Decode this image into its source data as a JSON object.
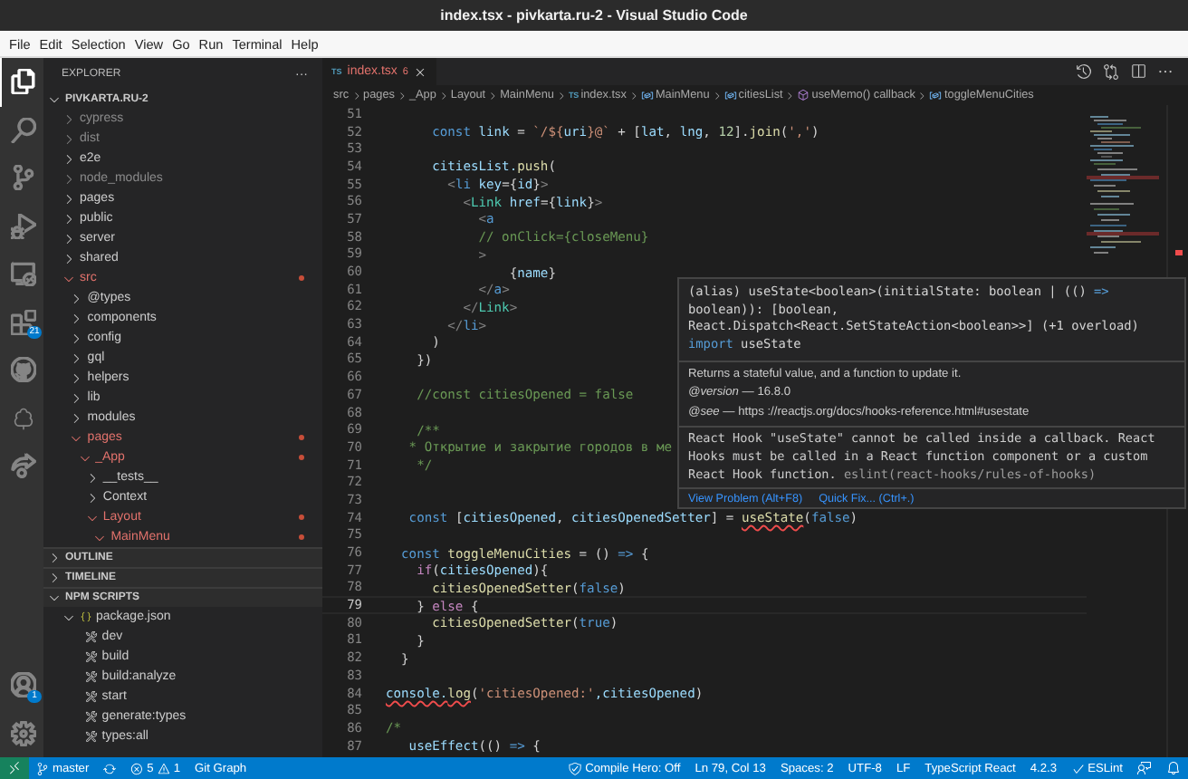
{
  "window": {
    "title": "index.tsx - pivkarta.ru-2 - Visual Studio Code"
  },
  "menu": [
    "File",
    "Edit",
    "Selection",
    "View",
    "Go",
    "Run",
    "Terminal",
    "Help"
  ],
  "activity_bar": {
    "top": [
      {
        "kind": "explorer",
        "selected": true
      },
      {
        "kind": "search",
        "selected": false
      },
      {
        "kind": "scm",
        "selected": false
      },
      {
        "kind": "debug",
        "selected": false
      },
      {
        "kind": "remote",
        "selected": false
      },
      {
        "kind": "extensions",
        "selected": false,
        "badge": "21"
      },
      {
        "kind": "github",
        "selected": false
      },
      {
        "kind": "tree",
        "selected": false
      },
      {
        "kind": "liveshare",
        "selected": false
      }
    ],
    "bottom": [
      {
        "kind": "account",
        "badge": "1"
      },
      {
        "kind": "settings"
      }
    ]
  },
  "sidebar": {
    "title": "EXPLORER",
    "more": "···",
    "project": {
      "title": "PIVKARTA.RU-2",
      "expanded": true,
      "items": [
        {
          "label": "cypress",
          "expanded": false,
          "modified": false,
          "ignored": true
        },
        {
          "label": "dist",
          "expanded": false,
          "modified": false,
          "ignored": true
        },
        {
          "label": "e2e",
          "expanded": false,
          "modified": false,
          "ignored": false
        },
        {
          "label": "node_modules",
          "expanded": false,
          "modified": false,
          "ignored": true
        },
        {
          "label": "pages",
          "expanded": false,
          "modified": false,
          "ignored": false
        },
        {
          "label": "public",
          "expanded": false,
          "modified": false,
          "ignored": false
        },
        {
          "label": "server",
          "expanded": false,
          "modified": false,
          "ignored": false
        },
        {
          "label": "shared",
          "expanded": false,
          "modified": false,
          "ignored": false
        },
        {
          "label": "src",
          "expanded": true,
          "modified": true,
          "ignored": false,
          "children": [
            {
              "label": "@types",
              "expanded": false,
              "modified": false,
              "ignored": false
            },
            {
              "label": "components",
              "expanded": false,
              "modified": false,
              "ignored": false
            },
            {
              "label": "config",
              "expanded": false,
              "modified": false,
              "ignored": false
            },
            {
              "label": "gql",
              "expanded": false,
              "modified": false,
              "ignored": false
            },
            {
              "label": "helpers",
              "expanded": false,
              "modified": false,
              "ignored": false
            },
            {
              "label": "lib",
              "expanded": false,
              "modified": false,
              "ignored": false
            },
            {
              "label": "modules",
              "expanded": false,
              "modified": false,
              "ignored": false
            },
            {
              "label": "pages",
              "expanded": true,
              "modified": true,
              "ignored": false,
              "children": [
                {
                  "label": "_App",
                  "expanded": true,
                  "modified": true,
                  "ignored": false,
                  "children": [
                    {
                      "label": "__tests__",
                      "expanded": false,
                      "modified": false,
                      "ignored": false
                    },
                    {
                      "label": "Context",
                      "expanded": false,
                      "modified": false,
                      "ignored": false
                    },
                    {
                      "label": "Layout",
                      "expanded": true,
                      "modified": true,
                      "ignored": false,
                      "children": [
                        {
                          "label": "MainMenu",
                          "expanded": true,
                          "modified": true,
                          "ignored": false
                        }
                      ]
                    }
                  ]
                }
              ]
            }
          ]
        }
      ]
    },
    "sections": [
      {
        "title": "OUTLINE",
        "expanded": false
      },
      {
        "title": "TIMELINE",
        "expanded": false
      },
      {
        "title": "NPM SCRIPTS",
        "expanded": true,
        "items": [
          {
            "kind": "package",
            "label": "package.json",
            "expanded": true,
            "children": [
              {
                "kind": "script",
                "label": "dev"
              },
              {
                "kind": "script",
                "label": "build"
              },
              {
                "kind": "script",
                "label": "build:analyze"
              },
              {
                "kind": "script",
                "label": "start"
              },
              {
                "kind": "script",
                "label": "generate:types"
              },
              {
                "kind": "script",
                "label": "types:all"
              }
            ]
          }
        ]
      }
    ]
  },
  "tabs": [
    {
      "file_icon": "TS",
      "label": "index.tsx",
      "problems": "6",
      "selected": true
    }
  ],
  "breadcrumbs": [
    {
      "kind": "folder",
      "text": "src"
    },
    {
      "kind": "folder",
      "text": "pages"
    },
    {
      "kind": "folder",
      "text": "_App"
    },
    {
      "kind": "folder",
      "text": "Layout"
    },
    {
      "kind": "folder",
      "text": "MainMenu"
    },
    {
      "kind": "file",
      "file_icon": "TS",
      "text": "index.tsx"
    },
    {
      "kind": "symbol",
      "text": "MainMenu"
    },
    {
      "kind": "symbol",
      "text": "citiesList"
    },
    {
      "kind": "method",
      "text": "useMemo() callback"
    },
    {
      "kind": "symbol",
      "text": "toggleMenuCities"
    }
  ],
  "editor": {
    "lines": [
      {
        "number": "51",
        "current": false
      },
      {
        "number": "52",
        "current": false,
        "tokens": [
          {
            "kind": "kw",
            "text": "      const"
          },
          {
            "kind": "var",
            "text": " link"
          },
          {
            "kind": "plain",
            "text": " = "
          },
          {
            "kind": "str",
            "text": "`/${"
          },
          {
            "kind": "var",
            "text": "uri"
          },
          {
            "kind": "str",
            "text": "}@`"
          },
          {
            "kind": "plain",
            "text": " + ["
          },
          {
            "kind": "var",
            "text": "lat"
          },
          {
            "kind": "plain",
            "text": ", "
          },
          {
            "kind": "var",
            "text": "lng"
          },
          {
            "kind": "plain",
            "text": ", "
          },
          {
            "kind": "num",
            "text": "12"
          },
          {
            "kind": "plain",
            "text": "]."
          },
          {
            "kind": "fn",
            "text": "join"
          },
          {
            "kind": "plain",
            "text": "("
          },
          {
            "kind": "str",
            "text": "','"
          },
          {
            "kind": "plain",
            "text": ")"
          }
        ]
      },
      {
        "number": "53",
        "current": false
      },
      {
        "number": "54",
        "current": false,
        "tokens": [
          {
            "kind": "var",
            "text": "      citiesList."
          },
          {
            "kind": "fn",
            "text": "push"
          },
          {
            "kind": "plain",
            "text": "("
          }
        ]
      },
      {
        "number": "55",
        "current": false,
        "tokens": [
          {
            "kind": "punct",
            "text": "        <"
          },
          {
            "kind": "tag",
            "text": "li"
          },
          {
            "kind": "var",
            "text": " key"
          },
          {
            "kind": "plain",
            "text": "={"
          },
          {
            "kind": "var",
            "text": "id"
          },
          {
            "kind": "plain",
            "text": "}"
          },
          {
            "kind": "punct",
            "text": ">"
          }
        ]
      },
      {
        "number": "56",
        "current": false,
        "tokens": [
          {
            "kind": "punct",
            "text": "          <"
          },
          {
            "kind": "comp",
            "text": "Link"
          },
          {
            "kind": "var",
            "text": " href"
          },
          {
            "kind": "plain",
            "text": "={"
          },
          {
            "kind": "var",
            "text": "link"
          },
          {
            "kind": "plain",
            "text": "}"
          },
          {
            "kind": "punct",
            "text": ">"
          }
        ]
      },
      {
        "number": "57",
        "current": false,
        "tokens": [
          {
            "kind": "punct",
            "text": "            <"
          },
          {
            "kind": "tag",
            "text": "a"
          }
        ]
      },
      {
        "number": "58",
        "current": false,
        "tokens": [
          {
            "kind": "comment",
            "text": "            // onClick={closeMenu}"
          }
        ]
      },
      {
        "number": "59",
        "current": false,
        "tokens": [
          {
            "kind": "punct",
            "text": "            >"
          }
        ]
      },
      {
        "number": "60",
        "current": false,
        "tokens": [
          {
            "kind": "plain",
            "text": "                {"
          },
          {
            "kind": "var",
            "text": "name"
          },
          {
            "kind": "plain",
            "text": "}"
          }
        ]
      },
      {
        "number": "61",
        "current": false,
        "tokens": [
          {
            "kind": "punct",
            "text": "            </"
          },
          {
            "kind": "tag",
            "text": "a"
          },
          {
            "kind": "punct",
            "text": ">"
          }
        ]
      },
      {
        "number": "62",
        "current": false,
        "tokens": [
          {
            "kind": "punct",
            "text": "          </"
          },
          {
            "kind": "comp",
            "text": "Link"
          },
          {
            "kind": "punct",
            "text": ">"
          }
        ]
      },
      {
        "number": "63",
        "current": false,
        "tokens": [
          {
            "kind": "punct",
            "text": "        </"
          },
          {
            "kind": "tag",
            "text": "li"
          },
          {
            "kind": "punct",
            "text": ">"
          }
        ]
      },
      {
        "number": "64",
        "current": false,
        "tokens": [
          {
            "kind": "plain",
            "text": "      )"
          }
        ]
      },
      {
        "number": "65",
        "current": false,
        "tokens": [
          {
            "kind": "plain",
            "text": "    })"
          }
        ]
      },
      {
        "number": "66",
        "current": false
      },
      {
        "number": "67",
        "current": false,
        "tokens": [
          {
            "kind": "comment",
            "text": "    //const citiesOpened = false"
          }
        ]
      },
      {
        "number": "68",
        "current": false
      },
      {
        "number": "69",
        "current": false,
        "tokens": [
          {
            "kind": "comment",
            "text": "    /**"
          }
        ]
      },
      {
        "number": "70",
        "current": false,
        "tokens": [
          {
            "kind": "comment",
            "text": "   * Открытие и закрытие городов в ме"
          }
        ]
      },
      {
        "number": "71",
        "current": false,
        "tokens": [
          {
            "kind": "comment",
            "text": "    */"
          }
        ]
      },
      {
        "number": "72",
        "current": false
      },
      {
        "number": "73",
        "current": false
      },
      {
        "number": "74",
        "current": false,
        "tokens": [
          {
            "kind": "kw",
            "text": "   const"
          },
          {
            "kind": "plain",
            "text": " ["
          },
          {
            "kind": "var",
            "text": "citiesOpened"
          },
          {
            "kind": "plain",
            "text": ", "
          },
          {
            "kind": "var",
            "text": "citiesOpenedSetter"
          },
          {
            "kind": "plain",
            "text": "] = "
          },
          {
            "kind": "fn",
            "text": "useState",
            "squiggle": true
          },
          {
            "kind": "plain",
            "text": "("
          },
          {
            "kind": "kw",
            "text": "false"
          },
          {
            "kind": "plain",
            "text": ")"
          }
        ]
      },
      {
        "number": "75",
        "current": false
      },
      {
        "number": "76",
        "current": false,
        "tokens": [
          {
            "kind": "kw",
            "text": "  const"
          },
          {
            "kind": "fn",
            "text": " toggleMenuCities"
          },
          {
            "kind": "plain",
            "text": " = () "
          },
          {
            "kind": "kw",
            "text": "=>"
          },
          {
            "kind": "plain",
            "text": " {"
          }
        ]
      },
      {
        "number": "77",
        "current": false,
        "tokens": [
          {
            "kind": "ctrl",
            "text": "    if"
          },
          {
            "kind": "plain",
            "text": "("
          },
          {
            "kind": "var",
            "text": "citiesOpened"
          },
          {
            "kind": "plain",
            "text": "){"
          }
        ]
      },
      {
        "number": "78",
        "current": false,
        "tokens": [
          {
            "kind": "fn",
            "text": "      citiesOpenedSetter"
          },
          {
            "kind": "plain",
            "text": "("
          },
          {
            "kind": "kw",
            "text": "false"
          },
          {
            "kind": "plain",
            "text": ")"
          }
        ]
      },
      {
        "number": "79",
        "current": true,
        "tokens": [
          {
            "kind": "plain",
            "text": "    } "
          },
          {
            "kind": "ctrl",
            "text": "else"
          },
          {
            "kind": "plain",
            "text": " {"
          }
        ]
      },
      {
        "number": "80",
        "current": false,
        "tokens": [
          {
            "kind": "fn",
            "text": "      citiesOpenedSetter"
          },
          {
            "kind": "plain",
            "text": "("
          },
          {
            "kind": "kw",
            "text": "true"
          },
          {
            "kind": "plain",
            "text": ")"
          }
        ]
      },
      {
        "number": "81",
        "current": false,
        "tokens": [
          {
            "kind": "plain",
            "text": "    }"
          }
        ]
      },
      {
        "number": "82",
        "current": false,
        "tokens": [
          {
            "kind": "plain",
            "text": "  }"
          }
        ]
      },
      {
        "number": "83",
        "current": false
      },
      {
        "number": "84",
        "current": false,
        "tokens": [
          {
            "kind": "var",
            "text": "console.",
            "squiggle": true
          },
          {
            "kind": "fn",
            "text": "log",
            "squiggle": true
          },
          {
            "kind": "plain",
            "text": "("
          },
          {
            "kind": "str",
            "text": "'citiesOpened:'"
          },
          {
            "kind": "var",
            "text": ",citiesOpened"
          },
          {
            "kind": "plain",
            "text": ")"
          }
        ]
      },
      {
        "number": "85",
        "current": false
      },
      {
        "number": "86",
        "current": false,
        "tokens": [
          {
            "kind": "comment",
            "text": "/*"
          }
        ]
      },
      {
        "number": "87",
        "current": false,
        "tokens": [
          {
            "kind": "var",
            "text": "   useEffect"
          },
          {
            "kind": "plain",
            "text": "(() "
          },
          {
            "kind": "kw",
            "text": "=>"
          },
          {
            "kind": "plain",
            "text": " {"
          }
        ]
      }
    ]
  },
  "hover": {
    "signature": [
      {
        "tokens": [
          {
            "kind": "plain",
            "text": "(alias) useState<boolean>(initialState: boolean | (() "
          },
          {
            "kind": "kw",
            "text": "=>"
          }
        ]
      },
      {
        "tokens": [
          {
            "kind": "plain",
            "text": "boolean)): [boolean,"
          }
        ]
      },
      {
        "tokens": [
          {
            "kind": "plain",
            "text": "React.Dispatch<React.SetStateAction<boolean>>] (+1 overload)"
          }
        ]
      },
      {
        "tokens": [
          {
            "kind": "kw",
            "text": "import"
          },
          {
            "kind": "plain",
            "text": " useState"
          }
        ]
      }
    ],
    "doc": [
      "Returns a stateful value, and a function to update it.",
      "*@version* — 16.8.0",
      "*@see* — https ://reactjs.org/docs/hooks-reference.html#usestate"
    ],
    "problem": {
      "message": "React Hook \"useState\" cannot be called inside a callback. React Hooks must be called in a React function component or a custom React Hook function.",
      "source": "eslint(react-hooks/rules-of-hooks)"
    },
    "actions": [
      "View Problem (Alt+F8)",
      "Quick Fix... (Ctrl+.)"
    ]
  },
  "status_bar": {
    "left": [
      {
        "kind": "remote"
      },
      {
        "kind": "branch",
        "text": "master"
      },
      {
        "kind": "sync"
      },
      {
        "kind": "problems",
        "errors": "5",
        "warnings": "1"
      },
      {
        "kind": "text",
        "text": "Git Graph"
      }
    ],
    "right": [
      {
        "kind": "compile",
        "text": "Compile Hero: Off"
      },
      {
        "kind": "text",
        "text": "Ln 79, Col 13"
      },
      {
        "kind": "text",
        "text": "Spaces: 2"
      },
      {
        "kind": "text",
        "text": "UTF-8"
      },
      {
        "kind": "text",
        "text": "LF"
      },
      {
        "kind": "text",
        "text": "TypeScript React"
      },
      {
        "kind": "text",
        "text": "4.2.3"
      },
      {
        "kind": "check",
        "text": "ESLint"
      },
      {
        "kind": "feedback"
      },
      {
        "kind": "bell"
      }
    ]
  }
}
